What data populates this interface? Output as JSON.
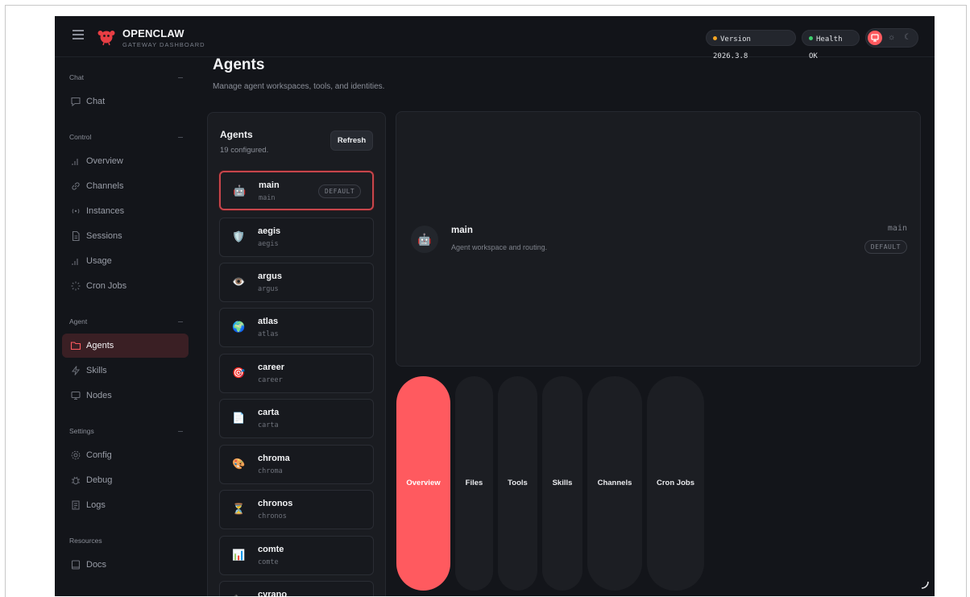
{
  "header": {
    "brand_title": "OPENCLAW",
    "brand_subtitle": "GATEWAY DASHBOARD",
    "version_label": "Version 2026.3.8",
    "health_label": "Health OK",
    "accent_color": "#ff5a5f"
  },
  "sidebar": {
    "sections": [
      {
        "title": "Chat",
        "items": [
          {
            "label": "Chat",
            "icon": "chat-bubble-icon"
          }
        ]
      },
      {
        "title": "Control",
        "items": [
          {
            "label": "Overview",
            "icon": "bar-chart-icon"
          },
          {
            "label": "Channels",
            "icon": "link-icon"
          },
          {
            "label": "Instances",
            "icon": "broadcast-icon"
          },
          {
            "label": "Sessions",
            "icon": "document-icon"
          },
          {
            "label": "Usage",
            "icon": "bar-chart-icon"
          },
          {
            "label": "Cron Jobs",
            "icon": "loader-icon"
          }
        ]
      },
      {
        "title": "Agent",
        "items": [
          {
            "label": "Agents",
            "icon": "folder-icon"
          },
          {
            "label": "Skills",
            "icon": "lightning-icon"
          },
          {
            "label": "Nodes",
            "icon": "monitor-icon"
          }
        ]
      },
      {
        "title": "Settings",
        "items": [
          {
            "label": "Config",
            "icon": "gear-icon"
          },
          {
            "label": "Debug",
            "icon": "bug-icon"
          },
          {
            "label": "Logs",
            "icon": "logs-icon"
          }
        ]
      },
      {
        "title": "Resources",
        "items": [
          {
            "label": "Docs",
            "icon": "book-icon"
          }
        ]
      }
    ],
    "active_item": "Agents"
  },
  "page": {
    "title": "Agents",
    "subtitle": "Manage agent workspaces, tools, and identities."
  },
  "agents_panel": {
    "title": "Agents",
    "count_label": "19 configured.",
    "refresh_label": "Refresh",
    "default_badge": "DEFAULT",
    "agents": [
      {
        "name": "main",
        "id": "main",
        "emoji": "🤖"
      },
      {
        "name": "aegis",
        "id": "aegis",
        "emoji": "🛡️"
      },
      {
        "name": "argus",
        "id": "argus",
        "emoji": "👁️"
      },
      {
        "name": "atlas",
        "id": "atlas",
        "emoji": "🌍"
      },
      {
        "name": "career",
        "id": "career",
        "emoji": "🎯"
      },
      {
        "name": "carta",
        "id": "carta",
        "emoji": "📄"
      },
      {
        "name": "chroma",
        "id": "chroma",
        "emoji": "🎨"
      },
      {
        "name": "chronos",
        "id": "chronos",
        "emoji": "⏳"
      },
      {
        "name": "comte",
        "id": "comte",
        "emoji": "📊"
      },
      {
        "name": "cyrano",
        "id": "cyrano",
        "emoji": "✒️"
      }
    ]
  },
  "detail": {
    "name": "main",
    "id": "main",
    "description": "Agent workspace and routing.",
    "badge": "DEFAULT",
    "emoji": "🤖"
  },
  "tabs": [
    {
      "label": "Overview",
      "active": true
    },
    {
      "label": "Files",
      "active": false
    },
    {
      "label": "Tools",
      "active": false
    },
    {
      "label": "Skills",
      "active": false
    },
    {
      "label": "Channels",
      "active": false
    },
    {
      "label": "Cron Jobs",
      "active": false
    }
  ]
}
